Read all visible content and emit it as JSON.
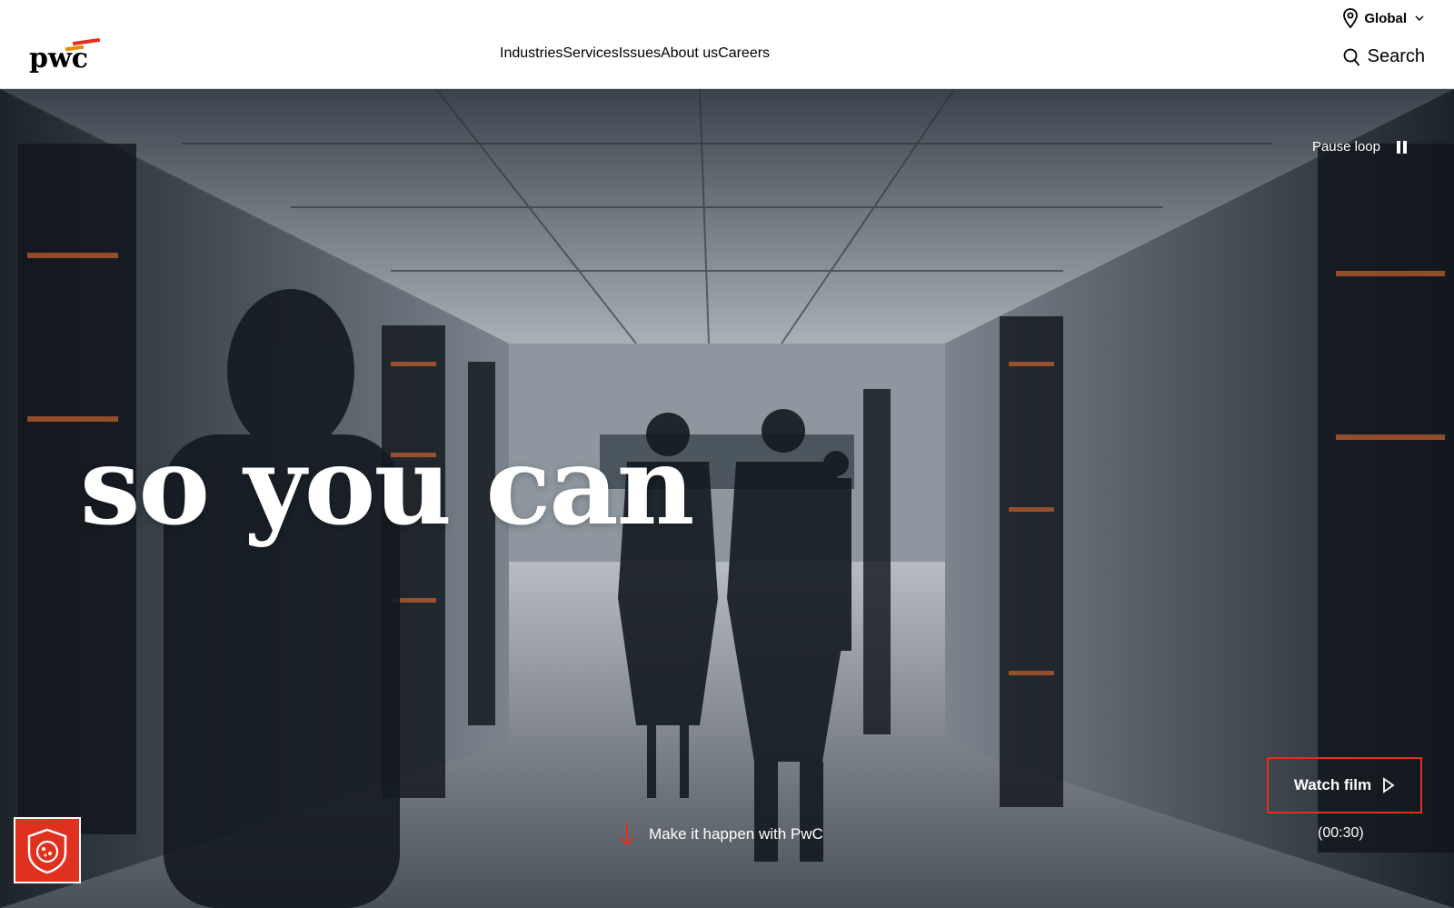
{
  "header": {
    "logo_text": "pwc",
    "region": {
      "label": "Global"
    },
    "nav": [
      {
        "label": "Industries"
      },
      {
        "label": "Services"
      },
      {
        "label": "Issues"
      },
      {
        "label": "About us"
      },
      {
        "label": "Careers"
      }
    ],
    "search_label": "Search"
  },
  "hero": {
    "headline": "so you can",
    "pause_label": "Pause loop",
    "watch_label": "Watch film",
    "duration": "(00:30)",
    "cta_label": "Make it happen with PwC"
  },
  "colors": {
    "accent": "#e0301e",
    "header_bg": "#ffffff",
    "text": "#000000"
  },
  "icons": {
    "region": "location-pin-icon",
    "chevron": "chevron-down-icon",
    "search": "search-icon",
    "pause": "pause-icon",
    "play": "play-icon",
    "arrow": "arrow-down-icon",
    "badge": "cookie-shield-icon"
  }
}
